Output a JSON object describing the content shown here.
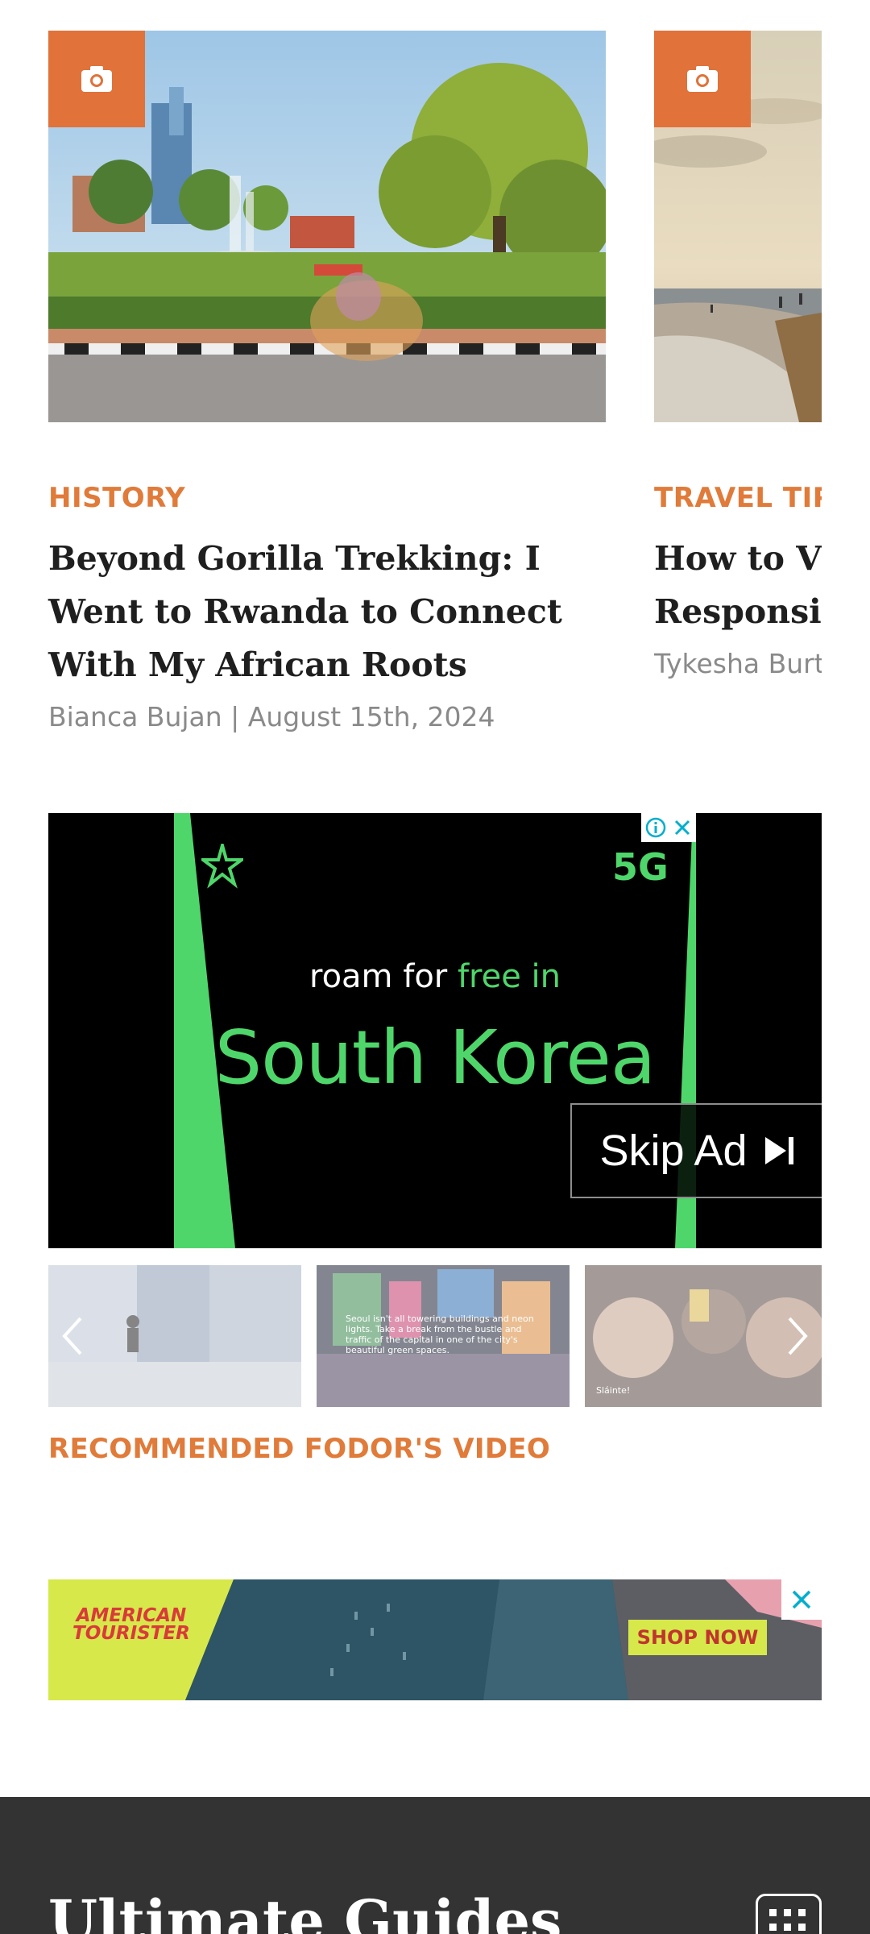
{
  "articles": [
    {
      "category": "HISTORY",
      "title": "Beyond Gorilla Trekking: I Went to Rwanda to Connect With My African Roots",
      "byline": "Bianca Bujan | August 15th, 2024",
      "image_icon": "camera-icon"
    },
    {
      "category": "TRAVEL TIPS",
      "title_line1": "How to Visi",
      "title_line2": "Responsibl",
      "byline": "Tykesha Burt",
      "image_icon": "camera-icon"
    }
  ],
  "video_ad": {
    "logo": "5G",
    "line1_prefix": "roam for ",
    "line1_highlight": "free in",
    "line2": "South Korea",
    "skip_label": "Skip Ad",
    "icons": [
      "info-icon",
      "close-icon",
      "skip-next-icon"
    ],
    "colors": {
      "accent": "#4fd66b",
      "background": "#000000"
    }
  },
  "video_thumbs": {
    "captions": [
      "",
      "Seoul isn't all towering buildings and neon lights. Take a break from the bustle and traffic of the capital in one of the city's beautiful green spaces.",
      "Sláinte!"
    ],
    "icons": [
      "chevron-left-icon",
      "chevron-right-icon"
    ]
  },
  "recommended_label": "RECOMMENDED FODOR'S VIDEO",
  "banner_ad": {
    "brand_line1": "AMERICAN",
    "brand_line2": "TOURISTER",
    "cta": "SHOP NOW"
  },
  "guides": {
    "title": "Ultimate Guides",
    "menu_icon": "grid-menu-icon"
  },
  "colors": {
    "accent": "#e07b3a",
    "badge": "#e0723a",
    "footer": "#333333"
  }
}
